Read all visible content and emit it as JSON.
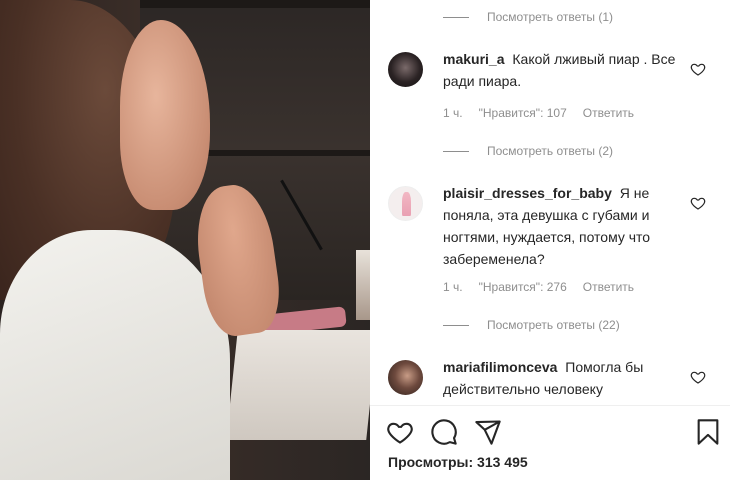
{
  "post": {
    "comments": [
      {
        "username": "makuri_a",
        "text": "Какой лживый пиар . Все ради пиара.",
        "time": "1 ч.",
        "likes": "\"Нравится\": 107",
        "reply": "Ответить",
        "view_replies": "Посмотреть ответы (2)"
      },
      {
        "username": "plaisir_dresses_for_baby",
        "text": "Я не поняла, эта девушка с губами и ногтями, нуждается, потому что забеременела?",
        "time": "1 ч.",
        "likes": "\"Нравится\": 276",
        "reply": "Ответить",
        "view_replies": "Посмотреть ответы (22)"
      },
      {
        "username": "mariafilimonceva",
        "text": "Помогла бы действительно человеку"
      }
    ],
    "top_view_replies": "Посмотреть ответы (1)",
    "views_label": "Просмотры: 313 495",
    "icons": [
      "heart-icon",
      "comment-icon",
      "share-icon",
      "bookmark-icon"
    ]
  }
}
